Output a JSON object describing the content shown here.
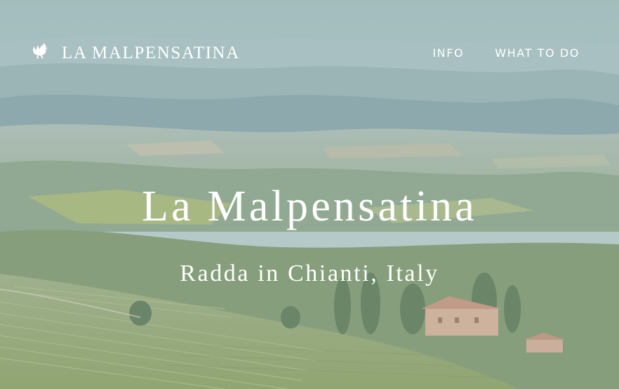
{
  "site": {
    "brand_name": "LA MALPENSATINA",
    "logo_icon": "rooster-icon"
  },
  "nav": {
    "items": [
      {
        "label": "INFO"
      },
      {
        "label": "WHAT TO DO"
      }
    ]
  },
  "hero": {
    "title": "La Malpensatina",
    "subtitle": "Radda in Chianti, Italy",
    "background": "tuscan-hills-vineyard-landscape"
  },
  "colors": {
    "text": "#ffffff",
    "sky": "#a9c4c4",
    "hills_far": "#7fa0a8",
    "vineyard": "#8aa363"
  }
}
